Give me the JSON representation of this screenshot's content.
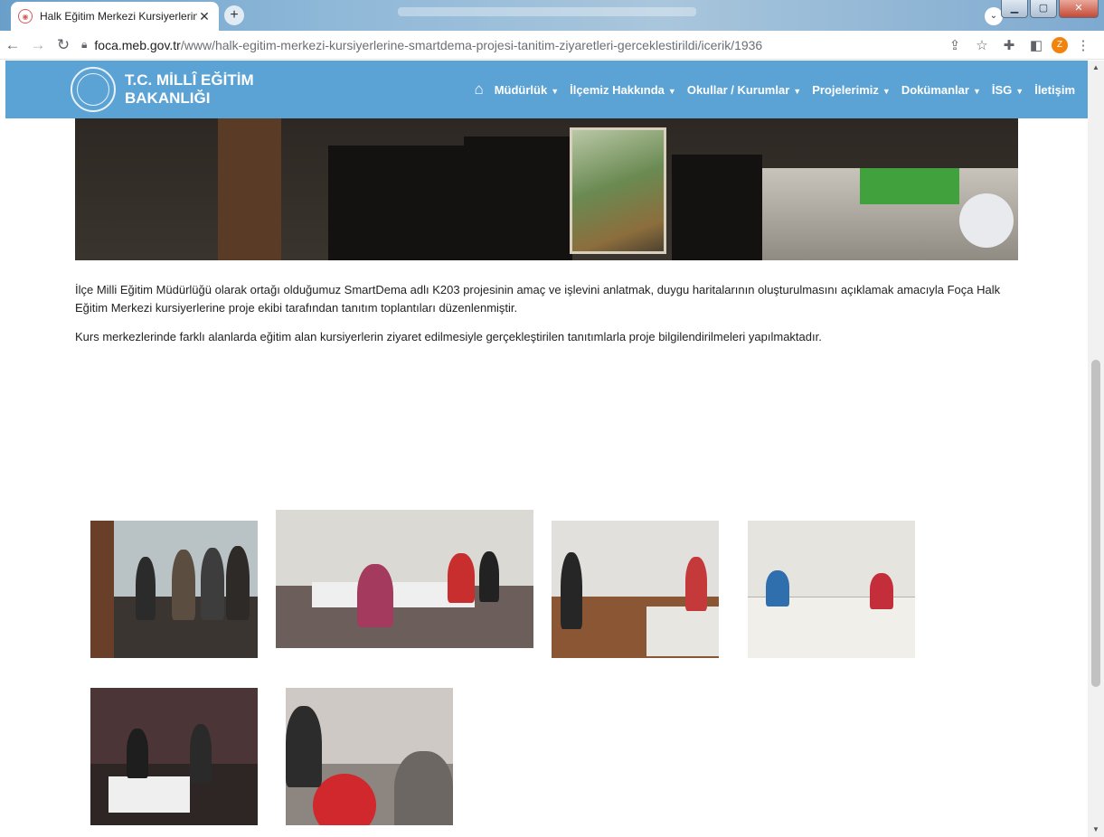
{
  "browser": {
    "tab_title": "Halk Eğitim Merkezi Kursiyerlerin",
    "tab_close": "✕",
    "new_tab": "+",
    "url_host": "foca.meb.gov.tr",
    "url_path": "/www/halk-egitim-merkezi-kursiyerlerine-smartdema-projesi-tanitim-ziyaretleri-gerceklestirildi/icerik/1936",
    "profile_initial": "Z"
  },
  "header": {
    "brand_line1": "T.C. MİLLÎ EĞİTİM",
    "brand_line2": "BAKANLIĞI",
    "menu": [
      {
        "label": "Müdürlük",
        "caret": "▼"
      },
      {
        "label": "İlçemiz Hakkında",
        "caret": "▼"
      },
      {
        "label": "Okullar / Kurumlar",
        "caret": "▼"
      },
      {
        "label": "Projelerimiz",
        "caret": "▼"
      },
      {
        "label": "Dokümanlar",
        "caret": "▼"
      },
      {
        "label": "İSG",
        "caret": "▼"
      },
      {
        "label": "İletişim",
        "caret": ""
      }
    ]
  },
  "article": {
    "p1": "İlçe Milli Eğitim Müdürlüğü olarak ortağı olduğumuz SmartDema adlı K203 projesinin amaç ve işlevini anlatmak, duygu haritalarının oluşturulmasını açıklamak amacıyla Foça Halk Eğitim Merkezi kursiyerlerine proje ekibi tarafından tanıtım toplantıları düzenlenmiştir.",
    "p2": "Kurs merkezlerinde farklı alanlarda eğitim alan kursiyerlerin ziyaret edilmesiyle gerçekleştirilen tanıtımlarla proje bilgilendirilmeleri yapılmaktadır."
  },
  "colors": {
    "header_bg": "#509cd2",
    "accent": "#f2840d"
  }
}
